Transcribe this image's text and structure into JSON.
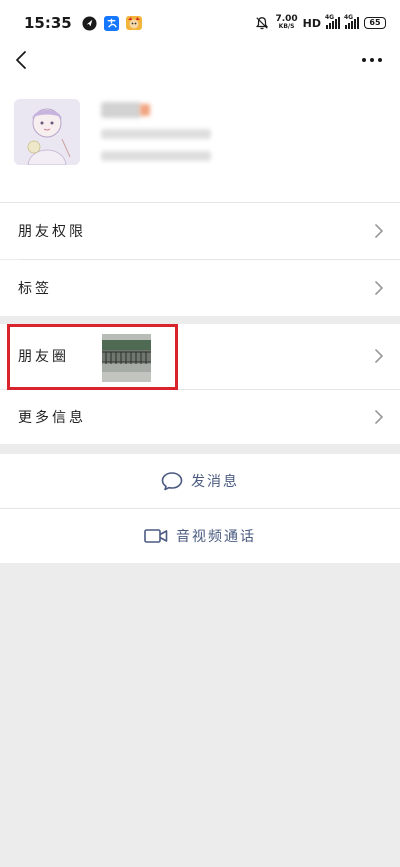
{
  "status_bar": {
    "time": "15:35",
    "net_speed_value": "7.00",
    "net_speed_unit": "KB/S",
    "hd_label": "HD",
    "signal1_tag": "4G",
    "signal2_tag": "4G",
    "battery": "65",
    "icons": [
      "app-notification-icon",
      "alipay-icon",
      "game-app-icon",
      "mute-bell-icon"
    ]
  },
  "nav": {
    "back_icon": "chevron-left-icon",
    "more_icon": "more-dots-icon"
  },
  "menu": {
    "friend_permissions": "朋友权限",
    "tags": "标签",
    "moments": "朋友圈",
    "more_info": "更多信息"
  },
  "actions": {
    "send_message": "发消息",
    "video_call": "音视频通话"
  },
  "colors": {
    "highlight_border": "#d9242e",
    "action_text": "#4a5a80",
    "background": "#ececec"
  }
}
